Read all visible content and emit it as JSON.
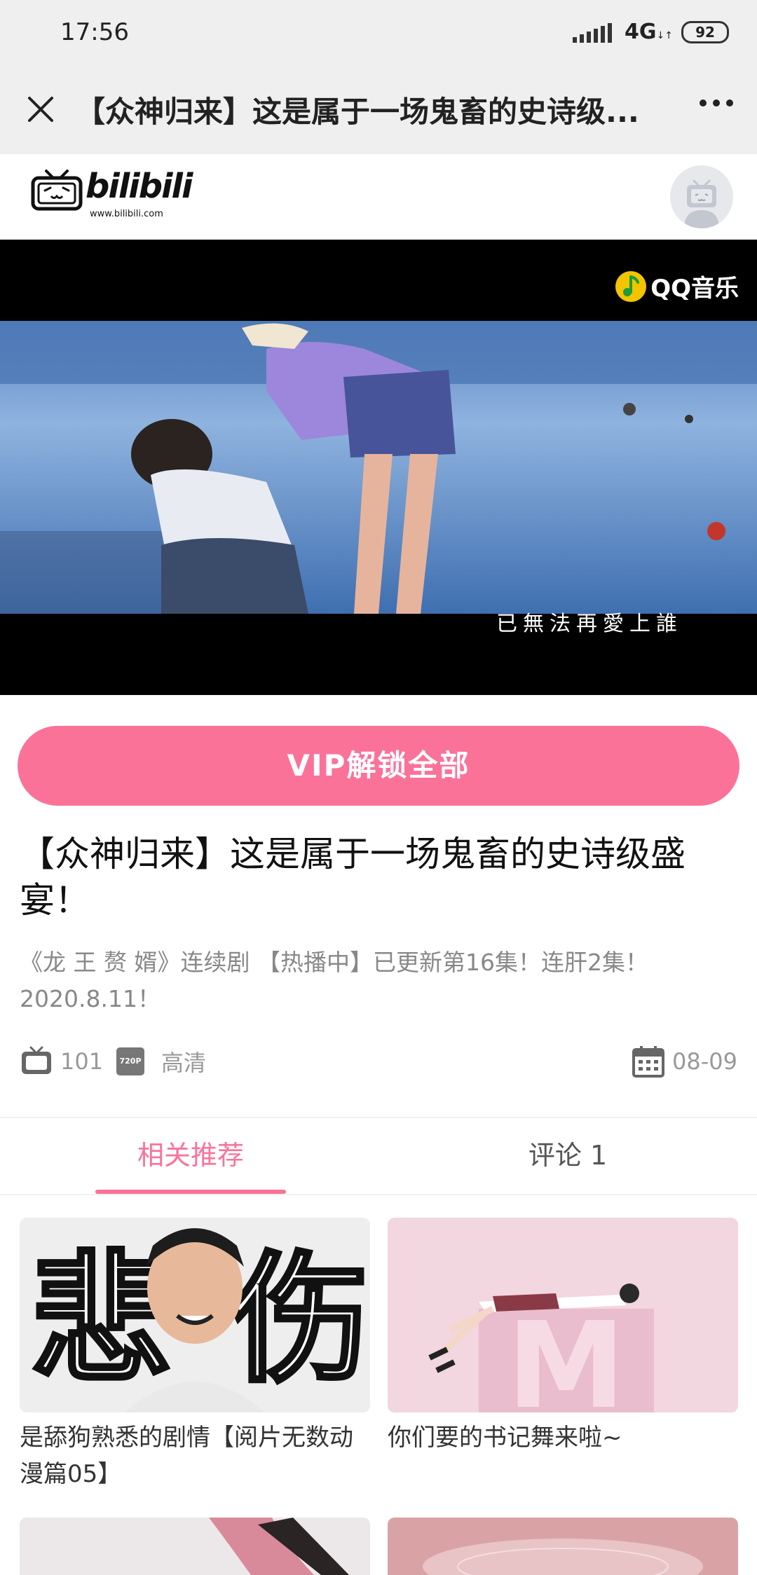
{
  "status_bar": {
    "time": "17:56",
    "network": "4G",
    "battery": "92"
  },
  "title_bar": {
    "title": "【众神归来】这是属于一场鬼畜的史诗级..."
  },
  "header": {
    "brand": "bilibili",
    "url": "www.bilibili.com"
  },
  "video": {
    "watermark": "QQ音乐",
    "subtitle": "已無法再愛上誰"
  },
  "vip_button": {
    "label": "VIP解锁全部"
  },
  "video_info": {
    "title": "【众神归来】这是属于一场鬼畜的史诗级盛宴！",
    "description": "《龙 王 赘 婿》连续剧 【热播中】已更新第16集！连肝2集！2020.8.11！",
    "plays": "101",
    "quality_badge": "720P",
    "quality": "高清",
    "date": "08-09"
  },
  "tabs": [
    {
      "label": "相关推荐",
      "active": true
    },
    {
      "label": "评论 1",
      "active": false
    }
  ],
  "recommendations": [
    {
      "title": "是舔狗熟悉的剧情【阅片无数动漫篇05】",
      "thumb_text_left": "悲",
      "thumb_text_right": "伤"
    },
    {
      "title": "你们要的书记舞来啦~",
      "thumb_text": "M"
    }
  ],
  "colors": {
    "accent": "#fb7299",
    "status_bg": "#efefef"
  }
}
